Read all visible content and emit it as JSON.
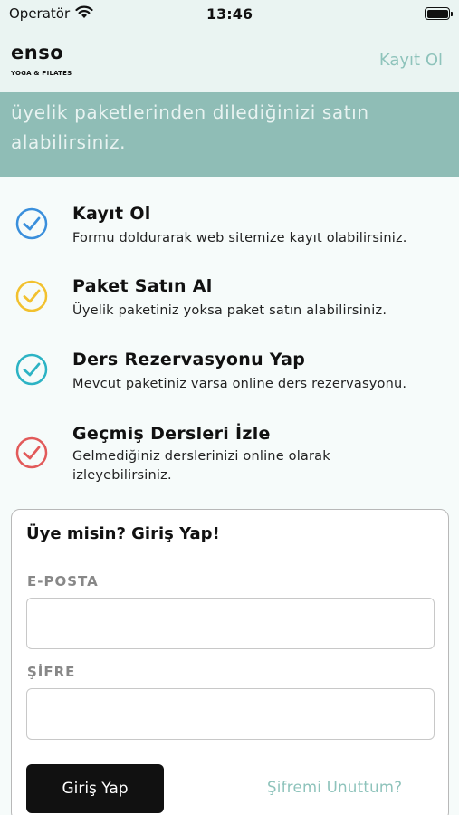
{
  "status_bar": {
    "carrier": "Operatör",
    "time": "13:46"
  },
  "header": {
    "logo_text": "enso",
    "logo_subtitle": "YOGA & PILATES",
    "register_link": "Kayıt Ol"
  },
  "hero": {
    "text_line1": "üyelik paketlerinden dilediğinizi satın",
    "text_line2": "alabilirsiniz."
  },
  "steps": [
    {
      "title": "Kayıt Ol",
      "description": "Formu doldurarak web sitemize kayıt olabilirsiniz.",
      "icon": "check-circle-icon",
      "color": "#3a8fdc"
    },
    {
      "title": "Paket Satın Al",
      "description": "Üyelik paketiniz yoksa paket satın alabilirsiniz.",
      "icon": "check-circle-icon",
      "color": "#f2c12e"
    },
    {
      "title": "Ders Rezervasyonu Yap",
      "description": "Mevcut paketiniz varsa online ders rezervasyonu.",
      "icon": "check-circle-icon",
      "color": "#2cb3c4"
    },
    {
      "title": "Geçmiş Dersleri İzle",
      "description": "Gelmediğiniz derslerinizi online olarak izleyebilirsiniz.",
      "icon": "check-circle-icon",
      "color": "#e25a5a"
    }
  ],
  "login": {
    "title": "Üye misin? Giriş Yap!",
    "email_label": "E-POSTA",
    "email_value": "",
    "password_label": "ŞİFRE",
    "password_value": "",
    "submit_label": "Giriş Yap",
    "forgot_label": "Şifremi Unuttum?"
  },
  "colors": {
    "accent": "#8ec3bb",
    "hero_bg": "#8fbdb6",
    "header_bg": "#eaf4f2"
  }
}
